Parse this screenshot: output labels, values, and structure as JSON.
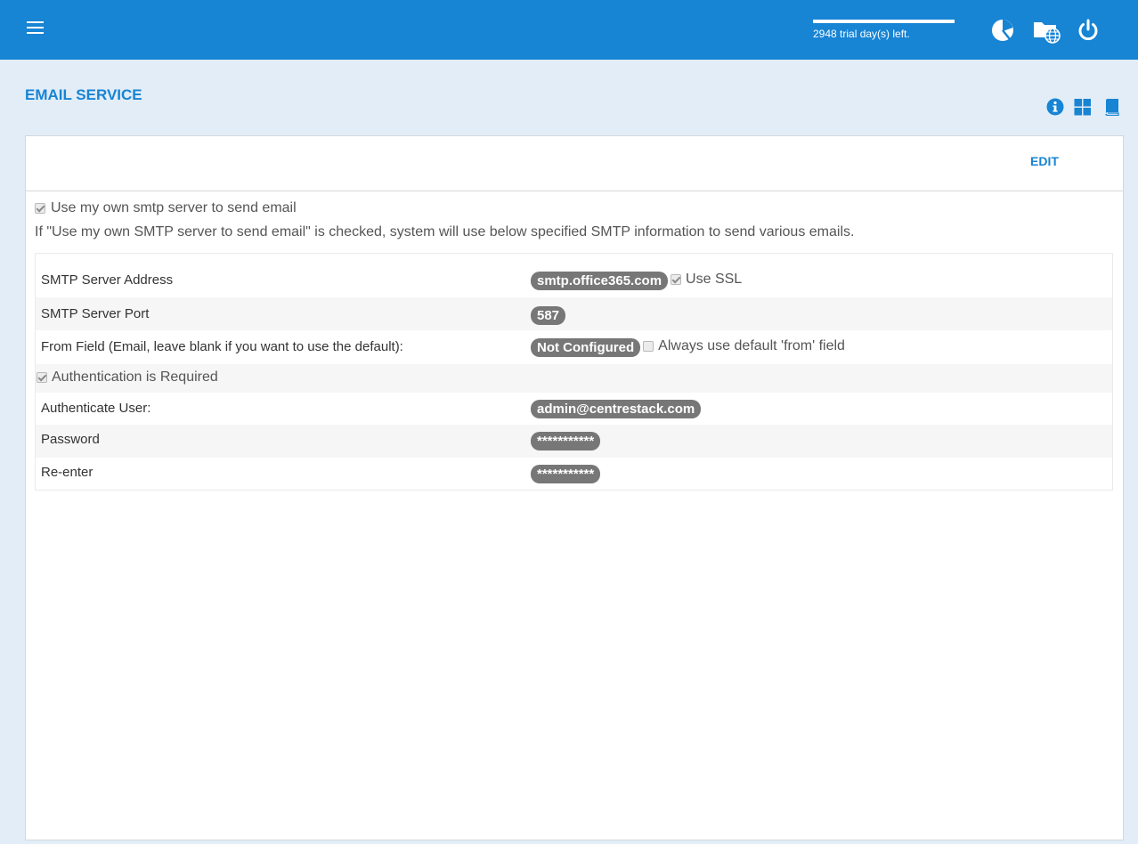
{
  "header": {
    "trial_text": "2948 trial day(s) left.",
    "icons": [
      "menu-icon",
      "pie-chart-icon",
      "folder-globe-icon",
      "power-icon"
    ]
  },
  "page": {
    "title": "EMAIL SERVICE",
    "tool_icons": [
      "info-icon",
      "grid-icon",
      "book-icon"
    ],
    "edit_label": "EDIT"
  },
  "settings": {
    "own_smtp_label": "Use my own smtp server to send email",
    "own_smtp_checked": true,
    "info_text": "If \"Use my own SMTP server to send email\" is checked, system will use below specified SMTP information to send various emails.",
    "server_label": "SMTP Server Address",
    "server_value": "smtp.office365.com",
    "ssl_label": "Use SSL",
    "port_label": "SMTP Server Port",
    "port_value": "587",
    "from_label": "From Field (Email, leave blank if you want to use the default):",
    "from_value": "Not Configured",
    "from_default_label": "Always use default 'from' field",
    "auth_label": "Authentication is Required",
    "user_label": "Authenticate User:",
    "user_value": "admin@centrestack.com",
    "password_label": "Password",
    "password_value": "***********",
    "reenter_label": "Re-enter",
    "reenter_value": "***********"
  },
  "colors": {
    "header_bg": "#1784d4",
    "page_bg": "#e2edf7",
    "pill_bg": "#777777"
  }
}
